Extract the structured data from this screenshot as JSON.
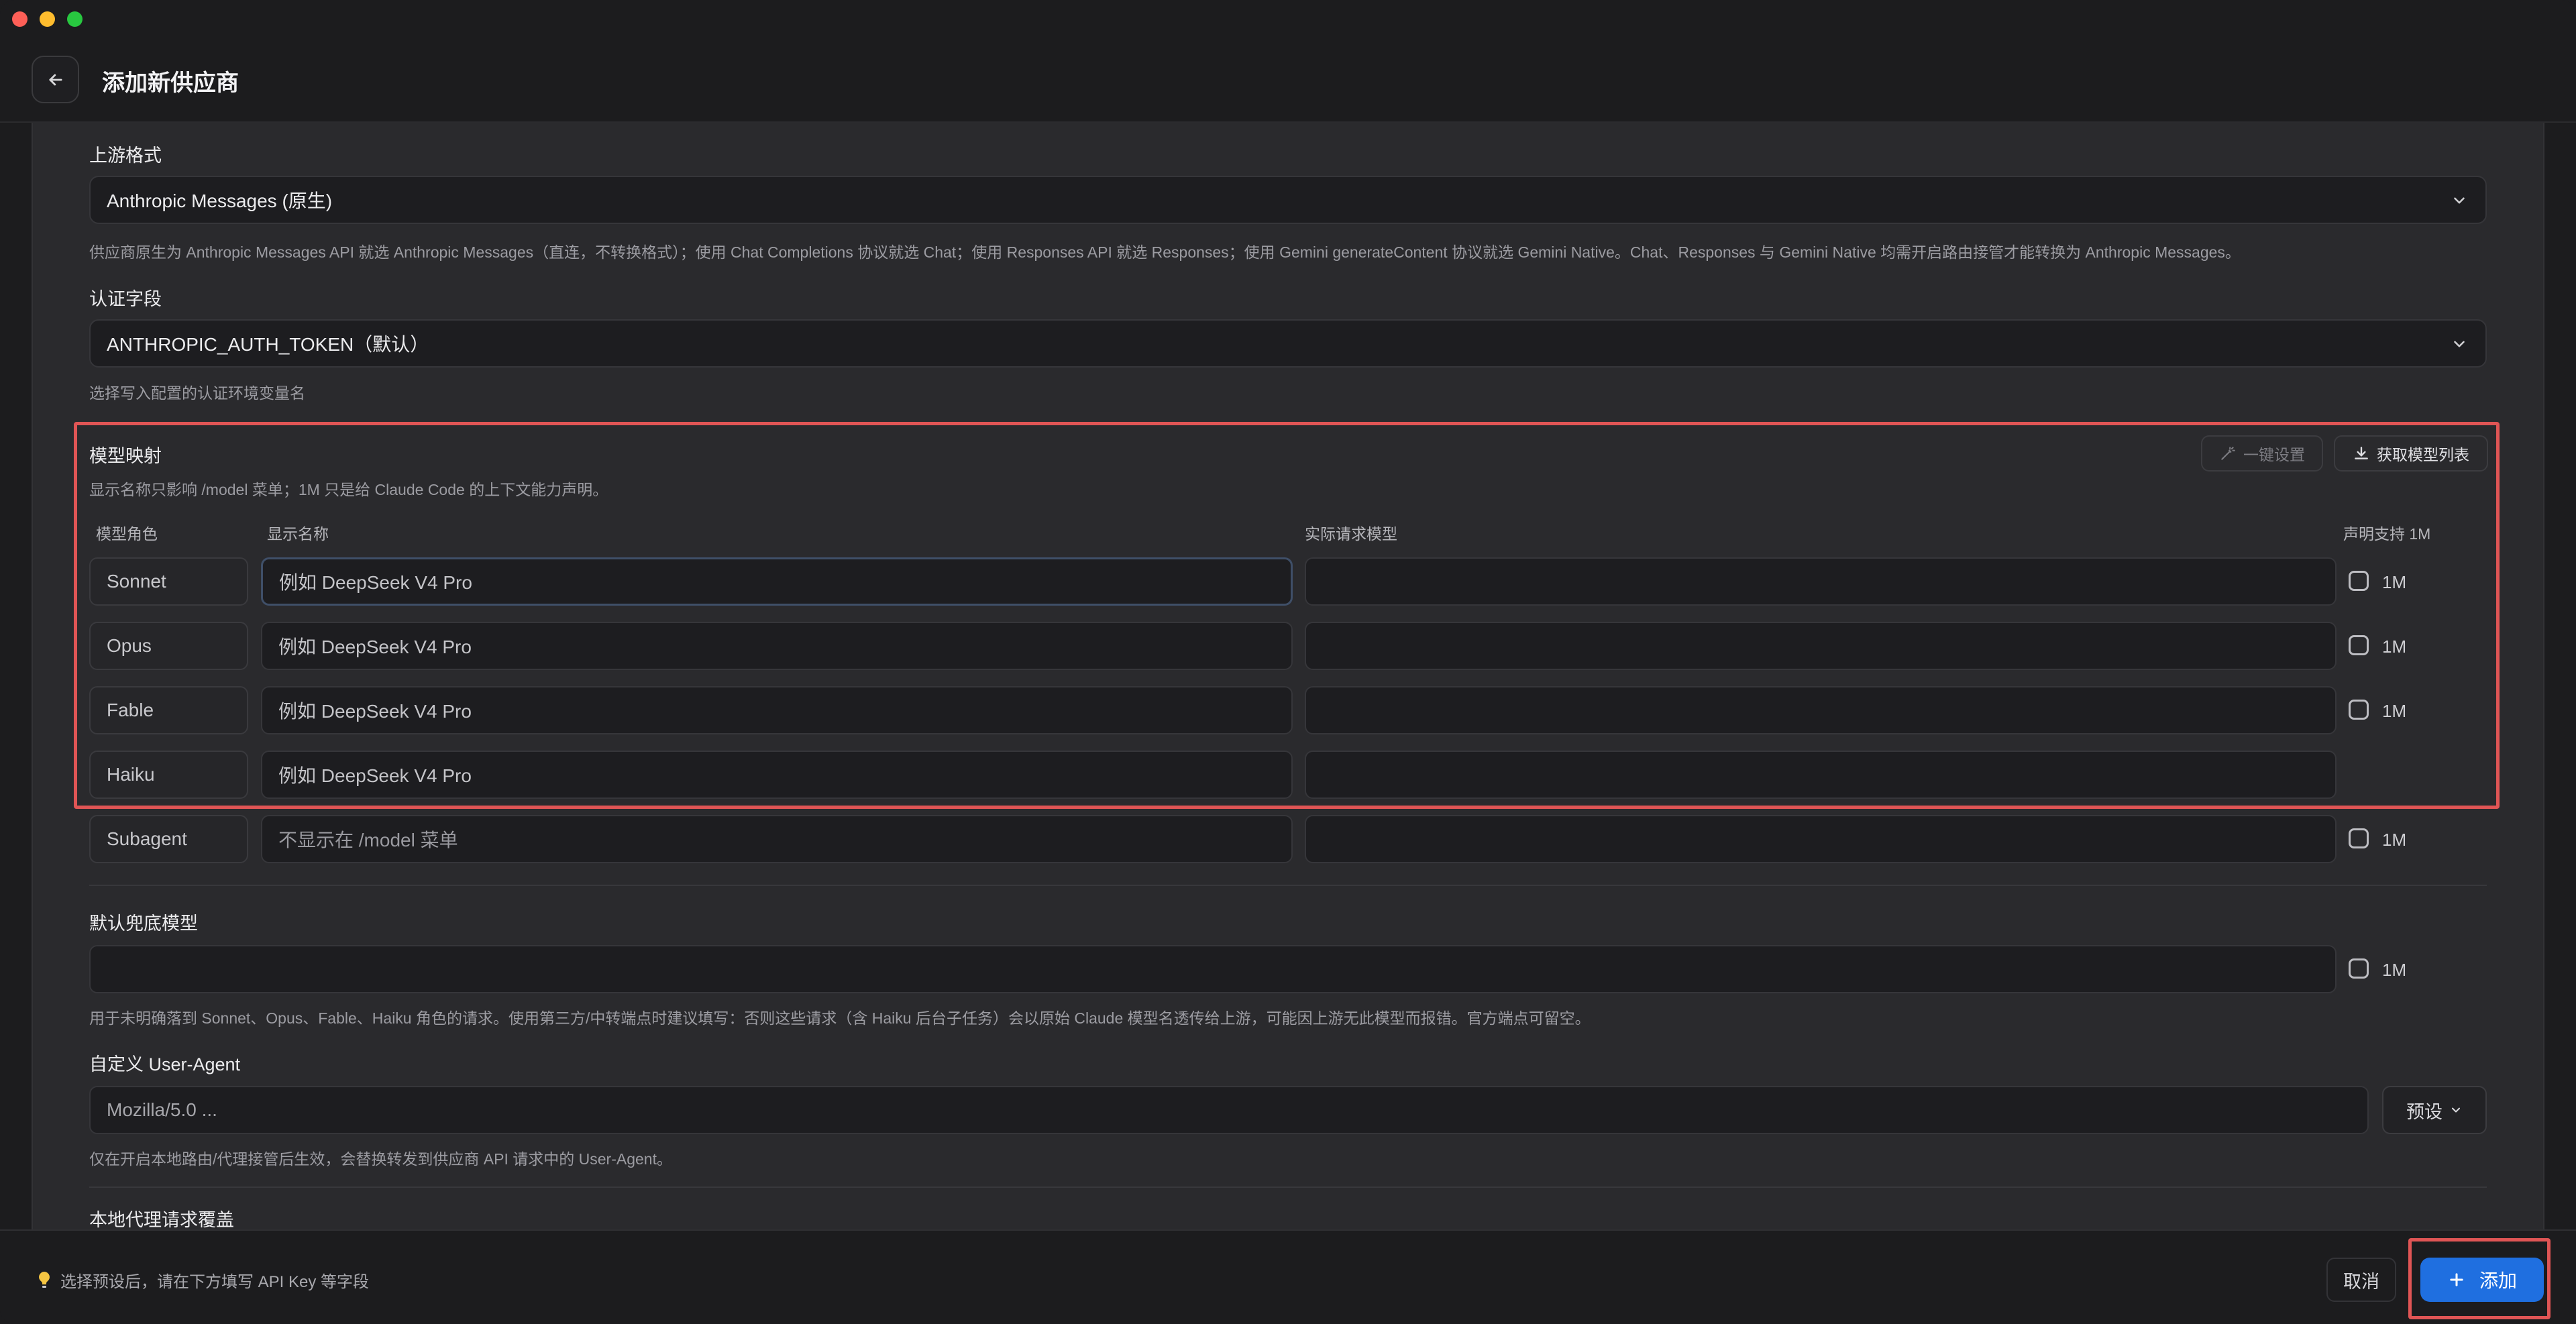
{
  "header": {
    "title": "添加新供应商"
  },
  "upstream": {
    "label": "上游格式",
    "selected": "Anthropic Messages (原生)",
    "hint": "供应商原生为 Anthropic Messages API 就选 Anthropic Messages（直连，不转换格式）；使用 Chat Completions 协议就选 Chat；使用 Responses API 就选 Responses；使用 Gemini generateContent 协议就选 Gemini Native。Chat、Responses 与 Gemini Native 均需开启路由接管才能转换为 Anthropic Messages。"
  },
  "auth": {
    "label": "认证字段",
    "selected": "ANTHROPIC_AUTH_TOKEN（默认）",
    "hint": "选择写入配置的认证环境变量名"
  },
  "mapping": {
    "title": "模型映射",
    "hint": "显示名称只影响 /model 菜单；1M 只是给 Claude Code 的上下文能力声明。",
    "one_click_label": "一键设置",
    "fetch_label": "获取模型列表",
    "columns": {
      "role": "模型角色",
      "display": "显示名称",
      "actual": "实际请求模型",
      "declare": "声明支持 1M"
    },
    "rows": [
      {
        "role": "Sonnet",
        "placeholder": "例如 DeepSeek V4 Pro",
        "actual": "",
        "check_label": "1M"
      },
      {
        "role": "Opus",
        "placeholder": "例如 DeepSeek V4 Pro",
        "actual": "",
        "check_label": "1M"
      },
      {
        "role": "Fable",
        "placeholder": "例如 DeepSeek V4 Pro",
        "actual": "",
        "check_label": "1M"
      },
      {
        "role": "Haiku",
        "placeholder": "例如 DeepSeek V4 Pro",
        "actual": ""
      }
    ],
    "subagent": {
      "role": "Subagent",
      "placeholder": "不显示在 /model 菜单",
      "actual": "",
      "check_label": "1M"
    }
  },
  "fallback": {
    "label": "默认兜底模型",
    "value": "",
    "check_label": "1M",
    "hint": "用于未明确落到 Sonnet、Opus、Fable、Haiku 角色的请求。使用第三方/中转端点时建议填写：否则这些请求（含 Haiku 后台子任务）会以原始 Claude 模型名透传给上游，可能因上游无此模型而报错。官方端点可留空。"
  },
  "user_agent": {
    "label": "自定义 User-Agent",
    "placeholder": "Mozilla/5.0 ...",
    "preset_label": "预设",
    "hint": "仅在开启本地路由/代理接管后生效，会替换转发到供应商 API 请求中的 User-Agent。"
  },
  "local_proxy": {
    "label": "本地代理请求覆盖"
  },
  "footer": {
    "hint": "选择预设后，请在下方填写 API Key 等字段",
    "cancel_label": "取消",
    "add_label": "添加"
  },
  "colors": {
    "accent": "#1f6fe0",
    "highlight": "#e05555"
  }
}
